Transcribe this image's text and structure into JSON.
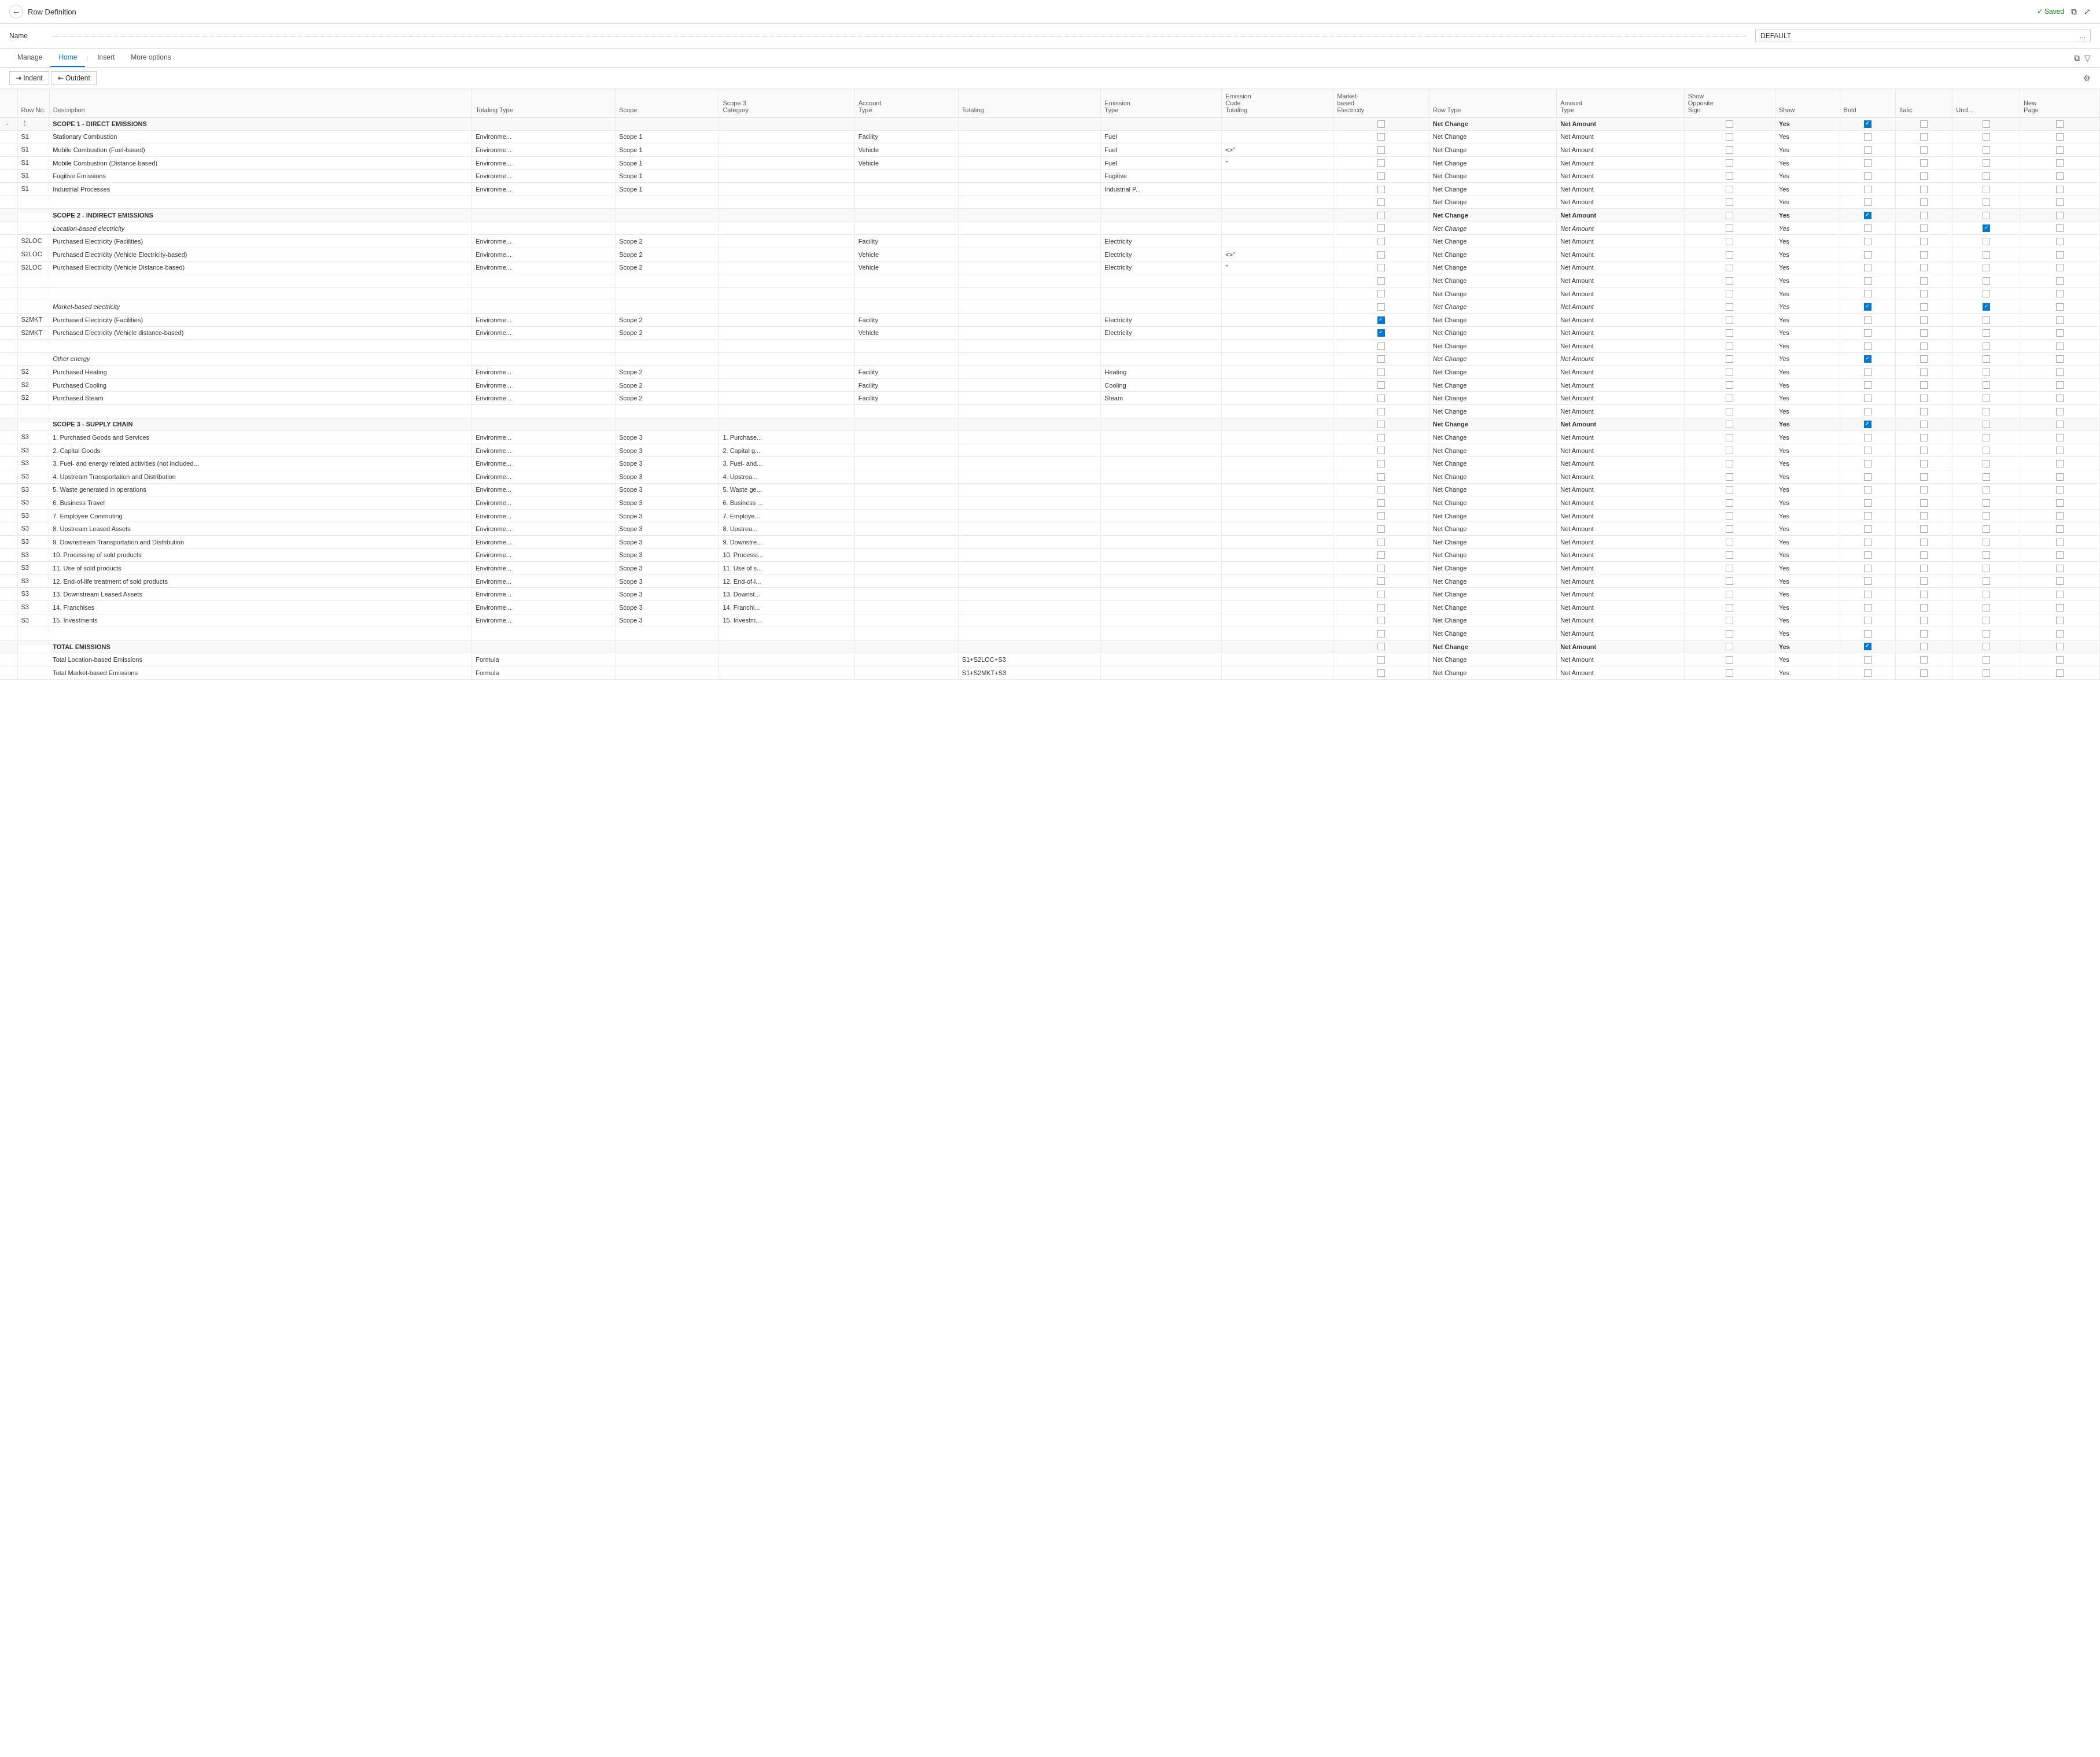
{
  "topBar": {
    "title": "Row Definition",
    "savedLabel": "✓ Saved",
    "backIcon": "←",
    "openIcon": "⧉",
    "expandIcon": "⤢"
  },
  "nameRow": {
    "label": "Name",
    "value": "DEFAULT",
    "ellipsis": "..."
  },
  "tabs": [
    {
      "label": "Manage",
      "active": false
    },
    {
      "label": "Home",
      "active": true
    },
    {
      "label": "Insert",
      "active": false
    },
    {
      "label": "More options",
      "active": false
    }
  ],
  "toolbar": {
    "indentLabel": "⇥ Indent",
    "outdentLabel": "⇤ Outdent"
  },
  "tableHeaders": [
    {
      "key": "rowNo",
      "label": "Row No."
    },
    {
      "key": "description",
      "label": "Description"
    },
    {
      "key": "totalingType",
      "label": "Totaling Type"
    },
    {
      "key": "scope",
      "label": "Scope"
    },
    {
      "key": "scope3Category",
      "label": "Scope 3 Category"
    },
    {
      "key": "accountType",
      "label": "Account Type"
    },
    {
      "key": "totaling",
      "label": "Totaling"
    },
    {
      "key": "emissionType",
      "label": "Emission Type"
    },
    {
      "key": "emissionCode",
      "label": "Emission Code Totaling"
    },
    {
      "key": "market",
      "label": "Market-based Electricity"
    },
    {
      "key": "rowType",
      "label": "Row Type"
    },
    {
      "key": "amountType",
      "label": "Amount Type"
    },
    {
      "key": "showOpp",
      "label": "Show Opposite Sign"
    },
    {
      "key": "show",
      "label": "Show"
    },
    {
      "key": "bold",
      "label": "Bold"
    },
    {
      "key": "italic",
      "label": "Italic"
    },
    {
      "key": "und",
      "label": "Und..."
    },
    {
      "key": "newPage",
      "label": "New Page"
    }
  ],
  "rows": [
    {
      "type": "section",
      "desc": "SCOPE 1 - DIRECT EMISSIONS",
      "rowNo": "",
      "bold": true,
      "checked_bold": true,
      "rowType": "Net Change",
      "amountType": "Net Amount",
      "show": "Yes"
    },
    {
      "type": "data",
      "rowNo": "S1",
      "desc": "Stationary Combustion",
      "totalingType": "Environme...",
      "scope": "Scope 1",
      "accountType": "Facility",
      "emissionType": "Fuel",
      "rowType": "Net Change",
      "amountType": "Net Amount",
      "show": "Yes"
    },
    {
      "type": "data",
      "rowNo": "S1",
      "desc": "Mobile Combustion (Fuel-based)",
      "totalingType": "Environme...",
      "scope": "Scope 1",
      "accountType": "Vehicle",
      "emissionType": "Fuel",
      "emissionCode": "<>\"",
      "rowType": "Net Change",
      "amountType": "Net Amount",
      "show": "Yes"
    },
    {
      "type": "data",
      "rowNo": "S1",
      "desc": "Mobile Combustion (Distance-based)",
      "totalingType": "Environme...",
      "scope": "Scope 1",
      "accountType": "Vehicle",
      "emissionType": "Fuel",
      "emissionCode": "\"",
      "rowType": "Net Change",
      "amountType": "Net Amount",
      "show": "Yes"
    },
    {
      "type": "data",
      "rowNo": "S1",
      "desc": "Fugitive Emissions",
      "totalingType": "Environme...",
      "scope": "Scope 1",
      "emissionType": "Fugitive",
      "rowType": "Net Change",
      "amountType": "Net Amount",
      "show": "Yes"
    },
    {
      "type": "data",
      "rowNo": "S1",
      "desc": "Industrial Processes",
      "totalingType": "Environme...",
      "scope": "Scope 1",
      "emissionType": "Industrial P...",
      "rowType": "Net Change",
      "amountType": "Net Amount",
      "show": "Yes"
    },
    {
      "type": "empty",
      "rowNo": "",
      "rowType": "Net Change",
      "amountType": "Net Amount",
      "show": "Yes"
    },
    {
      "type": "section",
      "desc": "SCOPE 2 - INDIRECT EMISSIONS",
      "rowNo": "",
      "bold": true,
      "checked_bold": true,
      "rowType": "Net Change",
      "amountType": "Net Amount",
      "show": "Yes"
    },
    {
      "type": "subheader",
      "desc": "Location-based electricity",
      "rowType": "Net Change",
      "amountType": "Net Amount",
      "show": "Yes",
      "checked_und": true
    },
    {
      "type": "data",
      "rowNo": "S2LOC",
      "desc": "Purchased Electricity (Facilities)",
      "totalingType": "Environme...",
      "scope": "Scope 2",
      "accountType": "Facility",
      "emissionType": "Electricity",
      "rowType": "Net Change",
      "amountType": "Net Amount",
      "show": "Yes"
    },
    {
      "type": "data",
      "rowNo": "S2LOC",
      "desc": "Purchased Electricity (Vehicle Electricity-based)",
      "totalingType": "Environme...",
      "scope": "Scope 2",
      "accountType": "Vehicle",
      "emissionType": "Electricity",
      "emissionCode": "<>\"",
      "rowType": "Net Change",
      "amountType": "Net Amount",
      "show": "Yes"
    },
    {
      "type": "data",
      "rowNo": "S2LOC",
      "desc": "Purchased Electricity (Vehicle Distance-based)",
      "totalingType": "Environme...",
      "scope": "Scope 2",
      "accountType": "Vehicle",
      "emissionType": "Electricity",
      "emissionCode": "\"",
      "rowType": "Net Change",
      "amountType": "Net Amount",
      "show": "Yes"
    },
    {
      "type": "empty",
      "rowType": "Net Change",
      "amountType": "Net Amount",
      "show": "Yes"
    },
    {
      "type": "empty",
      "rowType": "Net Change",
      "amountType": "Net Amount",
      "show": "Yes"
    },
    {
      "type": "subheader",
      "desc": "Market-based electricity",
      "rowType": "Net Change",
      "amountType": "Net Amount",
      "show": "Yes",
      "checked_bold": true,
      "checked_und": true
    },
    {
      "type": "data",
      "rowNo": "S2MKT",
      "desc": "Purchased Electricity (Facilities)",
      "totalingType": "Environme...",
      "scope": "Scope 2",
      "accountType": "Facility",
      "emissionType": "Electricity",
      "market": true,
      "rowType": "Net Change",
      "amountType": "Net Amount",
      "show": "Yes"
    },
    {
      "type": "data",
      "rowNo": "S2MKT",
      "desc": "Purchased Electricity (Vehicle distance-based)",
      "totalingType": "Environme...",
      "scope": "Scope 2",
      "accountType": "Vehicle",
      "emissionType": "Electricity",
      "market": true,
      "rowType": "Net Change",
      "amountType": "Net Amount",
      "show": "Yes"
    },
    {
      "type": "empty",
      "rowType": "Net Change",
      "amountType": "Net Amount",
      "show": "Yes"
    },
    {
      "type": "subheader",
      "desc": "Other energy",
      "rowType": "Net Change",
      "amountType": "Net Amount",
      "show": "Yes",
      "checked_bold": true
    },
    {
      "type": "data",
      "rowNo": "S2",
      "desc": "Purchased Heating",
      "totalingType": "Environme...",
      "scope": "Scope 2",
      "accountType": "Facility",
      "emissionType": "Heating",
      "rowType": "Net Change",
      "amountType": "Net Amount",
      "show": "Yes"
    },
    {
      "type": "data",
      "rowNo": "S2",
      "desc": "Purchased Cooling",
      "totalingType": "Environme...",
      "scope": "Scope 2",
      "accountType": "Facility",
      "emissionType": "Cooling",
      "rowType": "Net Change",
      "amountType": "Net Amount",
      "show": "Yes"
    },
    {
      "type": "data",
      "rowNo": "S2",
      "desc": "Purchased Steam",
      "totalingType": "Environme...",
      "scope": "Scope 2",
      "accountType": "Facility",
      "emissionType": "Steam",
      "rowType": "Net Change",
      "amountType": "Net Amount",
      "show": "Yes"
    },
    {
      "type": "empty",
      "rowType": "Net Change",
      "amountType": "Net Amount",
      "show": "Yes"
    },
    {
      "type": "section",
      "desc": "SCOPE 3 - SUPPLY CHAIN",
      "bold": true,
      "checked_bold": true,
      "rowType": "Net Change",
      "amountType": "Net Amount",
      "show": "Yes"
    },
    {
      "type": "data",
      "rowNo": "S3",
      "desc": "1. Purchased Goods and Services",
      "totalingType": "Environme...",
      "scope": "Scope 3",
      "scope3": "1. Purchase...",
      "rowType": "Net Change",
      "amountType": "Net Amount",
      "show": "Yes"
    },
    {
      "type": "data",
      "rowNo": "S3",
      "desc": "2. Capital Goods",
      "totalingType": "Environme...",
      "scope": "Scope 3",
      "scope3": "2. Capital g...",
      "rowType": "Net Change",
      "amountType": "Net Amount",
      "show": "Yes"
    },
    {
      "type": "data",
      "rowNo": "S3",
      "desc": "3. Fuel- and energy related activities (not included...",
      "totalingType": "Environme...",
      "scope": "Scope 3",
      "scope3": "3. Fuel- and...",
      "rowType": "Net Change",
      "amountType": "Net Amount",
      "show": "Yes"
    },
    {
      "type": "data",
      "rowNo": "S3",
      "desc": "4. Upstream Transportation and Distribution",
      "totalingType": "Environme...",
      "scope": "Scope 3",
      "scope3": "4. Upstrea...",
      "rowType": "Net Change",
      "amountType": "Net Amount",
      "show": "Yes"
    },
    {
      "type": "data",
      "rowNo": "S3",
      "desc": "5. Waste generated in operations",
      "totalingType": "Environme...",
      "scope": "Scope 3",
      "scope3": "5. Waste ge...",
      "rowType": "Net Change",
      "amountType": "Net Amount",
      "show": "Yes"
    },
    {
      "type": "data",
      "rowNo": "S3",
      "desc": "6. Business Travel",
      "totalingType": "Environme...",
      "scope": "Scope 3",
      "scope3": "6. Business ...",
      "rowType": "Net Change",
      "amountType": "Net Amount",
      "show": "Yes"
    },
    {
      "type": "data",
      "rowNo": "S3",
      "desc": "7. Employee Commuting",
      "totalingType": "Environme...",
      "scope": "Scope 3",
      "scope3": "7. Employe...",
      "rowType": "Net Change",
      "amountType": "Net Amount",
      "show": "Yes"
    },
    {
      "type": "data",
      "rowNo": "S3",
      "desc": "8. Upstream Leased Assets",
      "totalingType": "Environme...",
      "scope": "Scope 3",
      "scope3": "8. Upstrea...",
      "rowType": "Net Change",
      "amountType": "Net Amount",
      "show": "Yes"
    },
    {
      "type": "data",
      "rowNo": "S3",
      "desc": "9. Downstream Transportation and Distribution",
      "totalingType": "Environme...",
      "scope": "Scope 3",
      "scope3": "9. Downstre...",
      "rowType": "Net Change",
      "amountType": "Net Amount",
      "show": "Yes"
    },
    {
      "type": "data",
      "rowNo": "S3",
      "desc": "10. Processing of sold products",
      "totalingType": "Environme...",
      "scope": "Scope 3",
      "scope3": "10. Processi...",
      "rowType": "Net Change",
      "amountType": "Net Amount",
      "show": "Yes"
    },
    {
      "type": "data",
      "rowNo": "S3",
      "desc": "11. Use of sold products",
      "totalingType": "Environme...",
      "scope": "Scope 3",
      "scope3": "11. Use of s...",
      "rowType": "Net Change",
      "amountType": "Net Amount",
      "show": "Yes"
    },
    {
      "type": "data",
      "rowNo": "S3",
      "desc": "12. End-of-life treatment of sold products",
      "totalingType": "Environme...",
      "scope": "Scope 3",
      "scope3": "12. End-of-l...",
      "rowType": "Net Change",
      "amountType": "Net Amount",
      "show": "Yes"
    },
    {
      "type": "data",
      "rowNo": "S3",
      "desc": "13. Downstream Leased Assets",
      "totalingType": "Environme...",
      "scope": "Scope 3",
      "scope3": "13. Downst...",
      "rowType": "Net Change",
      "amountType": "Net Amount",
      "show": "Yes"
    },
    {
      "type": "data",
      "rowNo": "S3",
      "desc": "14. Franchises",
      "totalingType": "Environme...",
      "scope": "Scope 3",
      "scope3": "14. Franchi...",
      "rowType": "Net Change",
      "amountType": "Net Amount",
      "show": "Yes"
    },
    {
      "type": "data",
      "rowNo": "S3",
      "desc": "15. Investments",
      "totalingType": "Environme...",
      "scope": "Scope 3",
      "scope3": "15. Investm...",
      "rowType": "Net Change",
      "amountType": "Net Amount",
      "show": "Yes"
    },
    {
      "type": "empty",
      "rowType": "Net Change",
      "amountType": "Net Amount",
      "show": "Yes"
    },
    {
      "type": "section",
      "desc": "TOTAL EMISSIONS",
      "bold": true,
      "checked_bold": true,
      "rowType": "Net Change",
      "amountType": "Net Amount",
      "show": "Yes"
    },
    {
      "type": "data",
      "rowNo": "",
      "desc": "Total Location-based Emissions",
      "totalingType": "Formula",
      "totaling": "S1+S2LOC+S3",
      "rowType": "Net Change",
      "amountType": "Net Amount",
      "show": "Yes"
    },
    {
      "type": "data",
      "rowNo": "",
      "desc": "Total Market-based Emissions",
      "totalingType": "Formula",
      "totaling": "S1+S2MKT+S3",
      "rowType": "Net Change",
      "amountType": "Net Amount",
      "show": "Yes"
    }
  ]
}
